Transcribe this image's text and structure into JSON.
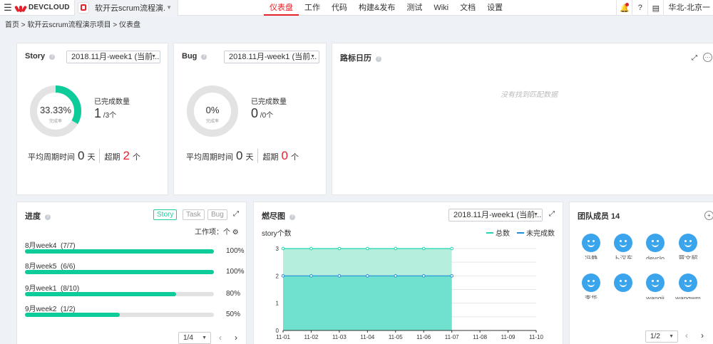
{
  "topbar": {
    "menu_icon": "menu-icon",
    "logo_text": "DEVCLOUD",
    "project_name": "软开云scrum流程演...",
    "nav": [
      "仪表盘",
      "工作",
      "代码",
      "构建&发布",
      "测试",
      "Wiki",
      "文档",
      "设置"
    ],
    "active_nav": "仪表盘",
    "tools": [
      "bell-icon",
      "help-icon",
      "doc-icon"
    ],
    "region": "华北-北京一"
  },
  "breadcrumb": "首页 > 软开云scrum流程演示项目 > 仪表盘",
  "story": {
    "title": "Story",
    "sprint": "2018.11月-week1 (当前...",
    "percent_text": "33.33%",
    "percent": 33.33,
    "rate_label": "完成率",
    "done_label": "已完成数量",
    "done": "1",
    "total": "3",
    "unit": "个",
    "cycle_label": "平均周期时间",
    "cycle_value": "0",
    "cycle_unit": "天",
    "overdue_label": "超期",
    "overdue_value": "2",
    "overdue_unit": "个"
  },
  "bug": {
    "title": "Bug",
    "sprint": "2018.11月-week1 (当前...",
    "percent_text": "0%",
    "percent": 0,
    "rate_label": "完成率",
    "done_label": "已完成数量",
    "done": "0",
    "total": "0",
    "unit": "个",
    "cycle_label": "平均周期时间",
    "cycle_value": "0",
    "cycle_unit": "天",
    "overdue_label": "超期",
    "overdue_value": "0",
    "overdue_unit": "个"
  },
  "milestone": {
    "title": "路标日历",
    "empty_text": "没有找到匹配数据"
  },
  "progress": {
    "title": "进度",
    "tabs": [
      "Story",
      "Task",
      "Bug"
    ],
    "active_tab": "Story",
    "worktype_label": "工作项：个",
    "rows": [
      {
        "label": "8月week4",
        "count": "(7/7)",
        "value": 100,
        "pct": "100%"
      },
      {
        "label": "8月week5",
        "count": "(6/6)",
        "value": 100,
        "pct": "100%"
      },
      {
        "label": "9月week1",
        "count": "(8/10)",
        "value": 80,
        "pct": "80%"
      },
      {
        "label": "9月week2",
        "count": "(1/2)",
        "value": 50,
        "pct": "50%"
      }
    ],
    "pager": "1/4"
  },
  "burndown": {
    "title": "燃尽图",
    "sprint": "2018.11月-week1 (当前...",
    "unit_label": "story个数",
    "colors": {
      "total": "#1fd6b0",
      "remaining": "#1d8fd8"
    }
  },
  "chart_data": {
    "type": "area",
    "x": [
      "11-01",
      "11-02",
      "11-03",
      "11-04",
      "11-05",
      "11-06",
      "11-07",
      "11-08",
      "11-09",
      "11-10"
    ],
    "series": [
      {
        "name": "总数",
        "values": [
          3,
          3,
          3,
          3,
          3,
          3,
          3,
          null,
          null,
          null
        ]
      },
      {
        "name": "未完成数",
        "values": [
          2,
          2,
          2,
          2,
          2,
          2,
          2,
          null,
          null,
          null
        ]
      }
    ],
    "ylim": [
      0,
      3
    ],
    "yticks": [
      "0",
      "1",
      "2",
      "3"
    ],
    "grid": true,
    "legend": "top-right"
  },
  "team": {
    "title": "团队成员 14",
    "members": [
      "冯静",
      "卜汉东",
      "devclo",
      "覃文超",
      "李华",
      "",
      "wangji",
      "wangwm"
    ],
    "pager": "1/2"
  }
}
